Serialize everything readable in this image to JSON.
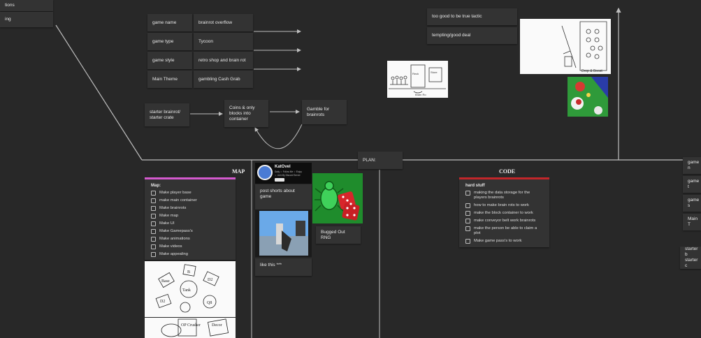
{
  "top_left_cards": [
    {
      "text": "tions"
    },
    {
      "text": "ing"
    }
  ],
  "concept_table": [
    {
      "label": "game name",
      "value": "brainrot overflow"
    },
    {
      "label": "game type",
      "value": "Tycoon"
    },
    {
      "label": "game style",
      "value": "retro shop and brain rot"
    },
    {
      "label": "Main Theme",
      "value": "gambling Cash Grab"
    }
  ],
  "flow": {
    "start": "starter brainrot/ starter crate",
    "middle": "Coins & only blocks into container",
    "end": "Gamble for brainrots"
  },
  "top_right_cards": [
    {
      "text": "too good to be true tactic"
    },
    {
      "text": "tempting/good deal"
    }
  ],
  "plan_label": "PLAN:",
  "map_column": {
    "title": "MAP",
    "accent": "#d65ad0",
    "heading": "Map:",
    "items": [
      "Make player base",
      "make main container",
      "Make brainrots",
      "Make map",
      "Make UI",
      "Make Gamepass's",
      "Make animations",
      "Make videos",
      "Make appealing"
    ],
    "sketch1_labels": [
      "Base",
      "B",
      "D2",
      "Tank",
      "Q8",
      "D2"
    ],
    "sketch2_labels": [
      "OP Crusher",
      "Decor"
    ]
  },
  "middle_column": {
    "profile_name": "KatOvel",
    "profile_lines": [
      "Daily ☆ Follow Me ☆ Enjoy",
      "☆ Join My Discord Server"
    ],
    "post_text": "post shorts about game",
    "dice_caption": "Bugged Out RNG",
    "video_caption": "like this ***"
  },
  "code_column": {
    "title": "CODE",
    "accent": "#c4262a",
    "heading": "hard stuff",
    "items": [
      "making the data storage for the players brainrots",
      "how to make brain rots to work",
      "make the block container to work",
      "make conveyor belt work brainrots",
      "make the person be able to claim a plot",
      "Make game pass's to work"
    ]
  },
  "right_edge_cards": [
    {
      "text": "game n"
    },
    {
      "text": "game t"
    },
    {
      "text": "game s"
    },
    {
      "text": "Main T"
    },
    {
      "text": "starter b starter c"
    }
  ],
  "sketch_top_right_label": "Drop & Boost",
  "sketch_mid_labels": [
    "Reck",
    "Store",
    "Brain Ro"
  ]
}
